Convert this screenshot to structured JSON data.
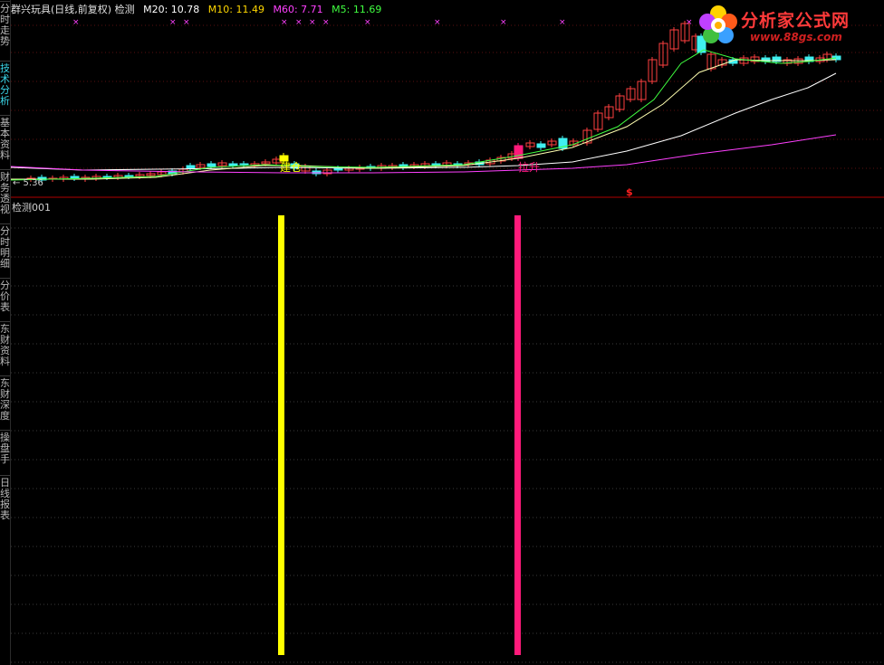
{
  "sidebar": {
    "tabs": [
      {
        "label": "分时走势",
        "active": false
      },
      {
        "label": "技术分析",
        "active": true
      },
      {
        "label": "基本资料",
        "active": false
      },
      {
        "label": "财务透视",
        "active": false
      },
      {
        "label": "分时明细",
        "active": false
      },
      {
        "label": "分价表",
        "active": false
      },
      {
        "label": "东财资料",
        "active": false
      },
      {
        "label": "东财深度",
        "active": false
      },
      {
        "label": "操盘手",
        "active": false
      },
      {
        "label": "日线报表",
        "active": false
      }
    ]
  },
  "header": {
    "stock_name": "群兴玩具(日线,前复权) 检测",
    "ma20": "M20: 10.78",
    "ma10": "M10: 11.49",
    "ma60": "M60: 7.71",
    "ma5": "M5: 11.69"
  },
  "main_chart": {
    "buy_label": "建仓",
    "sell_label": "拉升",
    "dollar_marker": "$",
    "low_price_label": "5.36",
    "colors": {
      "up": "#ff4040",
      "down": "#40f0f0",
      "ma5": "#ffffff",
      "ma10": "#ffd700",
      "ma20": "#40ff40",
      "ma60": "#ff40ff",
      "cross_marker": "#ff40ff"
    }
  },
  "indicator": {
    "title": "检测001",
    "bar_colors": {
      "yellow": "#ffff00",
      "pink": "#ff1a7a"
    }
  },
  "logo": {
    "text": "分析家公式网",
    "url": "www.88gs.com"
  }
}
